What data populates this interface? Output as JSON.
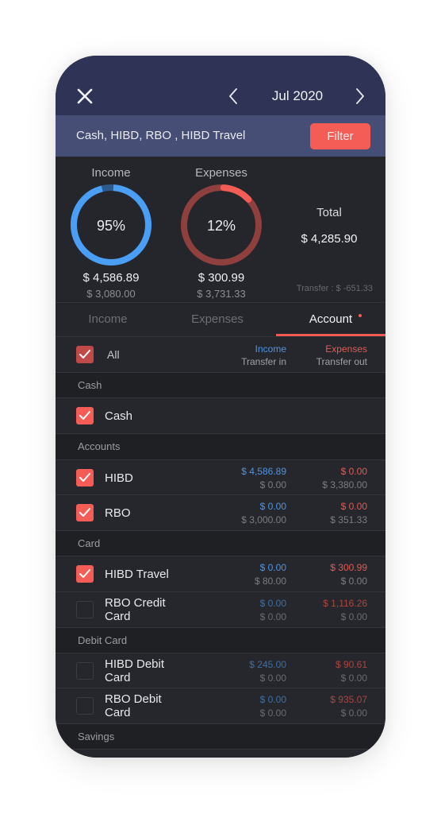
{
  "navbar": {
    "close_icon": "close-icon",
    "prev_icon": "chevron-left-icon",
    "next_icon": "chevron-right-icon",
    "title": "Jul 2020"
  },
  "filter_bar": {
    "selected_accounts": "Cash, HIBD, RBO , HIBD Travel",
    "filter_label": "Filter"
  },
  "summary": {
    "income": {
      "label": "Income",
      "percent_text": "95%",
      "percent": 95,
      "amount": "$ 4,586.89",
      "transfer_amount": "$ 3,080.00",
      "color": "#4a9ff5"
    },
    "expenses": {
      "label": "Expenses",
      "percent_text": "12%",
      "percent": 12,
      "amount": "$ 300.99",
      "transfer_amount": "$ 3,731.33",
      "color": "#f45d55",
      "track_color": "#8f3f3d"
    },
    "total_label": "Total",
    "total_value": "$ 4,285.90",
    "transfer_text": "Transfer : $ -651.33"
  },
  "tabs": [
    {
      "label": "Income",
      "active": false
    },
    {
      "label": "Expenses",
      "active": false
    },
    {
      "label": "Account",
      "active": true,
      "badge": true
    }
  ],
  "list_header": {
    "all_label": "All",
    "all_checked": true,
    "income_header": "Income",
    "transfer_in_header": "Transfer in",
    "expenses_header": "Expenses",
    "transfer_out_header": "Transfer out"
  },
  "sections": [
    {
      "label": "Cash",
      "accounts": [
        {
          "name": "Cash",
          "checked": true,
          "income": "",
          "transfer_in": "",
          "expenses": "",
          "transfer_out": ""
        }
      ]
    },
    {
      "label": "Accounts",
      "accounts": [
        {
          "name": "HIBD",
          "checked": true,
          "income": "$ 4,586.89",
          "transfer_in": "$ 0.00",
          "expenses": "$ 0.00",
          "transfer_out": "$ 3,380.00"
        },
        {
          "name": "RBO",
          "checked": true,
          "income": "$ 0.00",
          "transfer_in": "$ 3,000.00",
          "expenses": "$ 0.00",
          "transfer_out": "$ 351.33"
        }
      ]
    },
    {
      "label": "Card",
      "accounts": [
        {
          "name": "HIBD Travel",
          "checked": true,
          "income": "$ 0.00",
          "transfer_in": "$ 80.00",
          "expenses": "$ 300.99",
          "transfer_out": "$ 0.00"
        },
        {
          "name_line1": "RBO Credit",
          "name_line2": "Card",
          "checked": false,
          "income": "$ 0.00",
          "transfer_in": "$ 0.00",
          "expenses": "$ 1,116.26",
          "transfer_out": "$ 0.00"
        }
      ]
    },
    {
      "label": "Debit Card",
      "accounts": [
        {
          "name_line1": "HIBD Debit",
          "name_line2": "Card",
          "checked": false,
          "income": "$ 245.00",
          "transfer_in": "$ 0.00",
          "expenses": "$ 90.61",
          "transfer_out": "$ 0.00"
        },
        {
          "name_line1": "RBO Debit",
          "name_line2": "Card",
          "checked": false,
          "income": "$ 0.00",
          "transfer_in": "$ 0.00",
          "expenses": "$ 935.07",
          "transfer_out": "$ 0.00"
        }
      ]
    },
    {
      "label": "Savings",
      "accounts": []
    }
  ]
}
